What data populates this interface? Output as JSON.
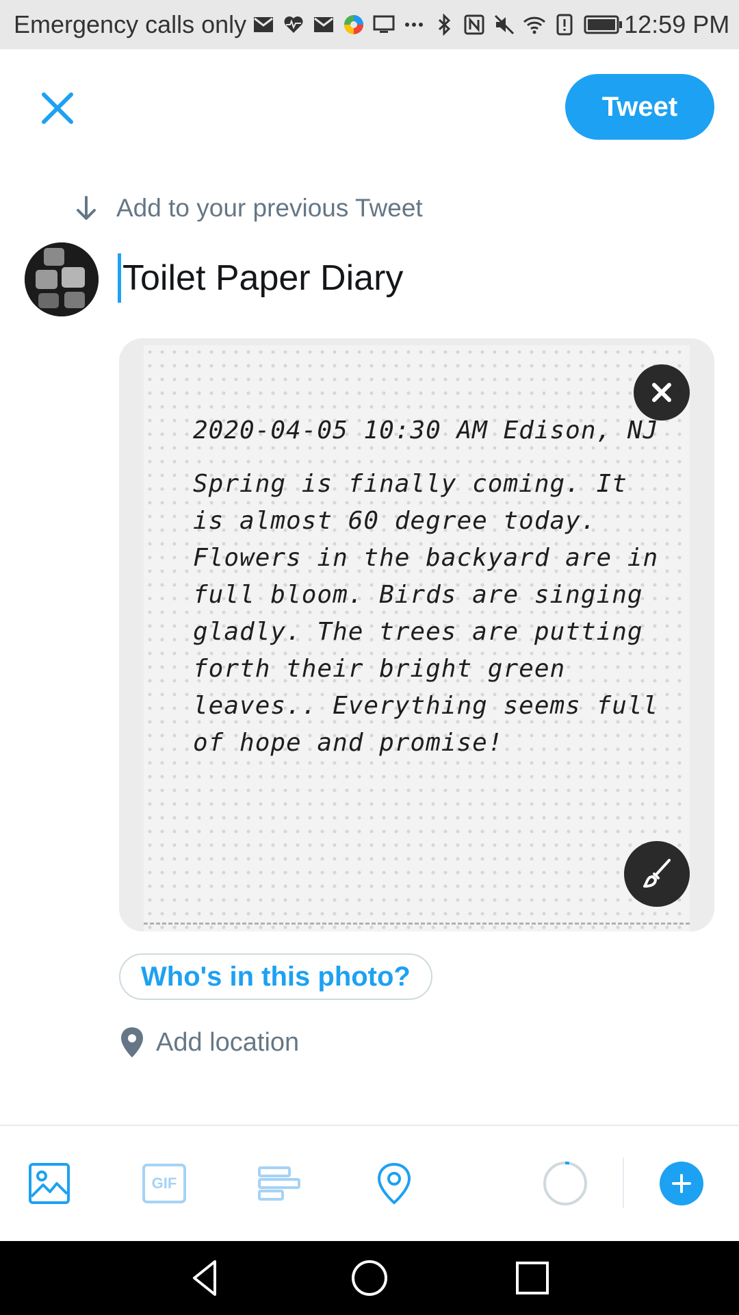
{
  "status_bar": {
    "carrier_text": "Emergency calls only",
    "time": "12:59 PM",
    "icons": [
      "mail-icon",
      "heart-pulse-icon",
      "mail-icon",
      "colorful-app-icon",
      "cast-icon",
      "more-icon",
      "bluetooth-icon",
      "nfc-icon",
      "mute-icon",
      "wifi-icon",
      "alert-icon",
      "battery-icon"
    ]
  },
  "header": {
    "tweet_label": "Tweet"
  },
  "thread": {
    "prev_label": "Add to your previous Tweet"
  },
  "compose": {
    "text": "Toilet Paper Diary"
  },
  "media": {
    "note_header": "2020-04-05 10:30 AM  Edison, NJ",
    "note_body": "Spring is finally coming. It is almost 60 degree today. Flowers in the backyard are in full bloom. Birds are singing gladly. The trees are putting forth their bright green leaves.. Everything seems full of hope and promise!"
  },
  "tag": {
    "who_label": "Who's in this photo?"
  },
  "location": {
    "label": "Add location"
  },
  "toolbar": {
    "gif_label": "GIF"
  },
  "colors": {
    "accent": "#1da1f2",
    "muted": "#657786",
    "status_bar": "#e8e8e8",
    "nav_bar": "#000000"
  }
}
